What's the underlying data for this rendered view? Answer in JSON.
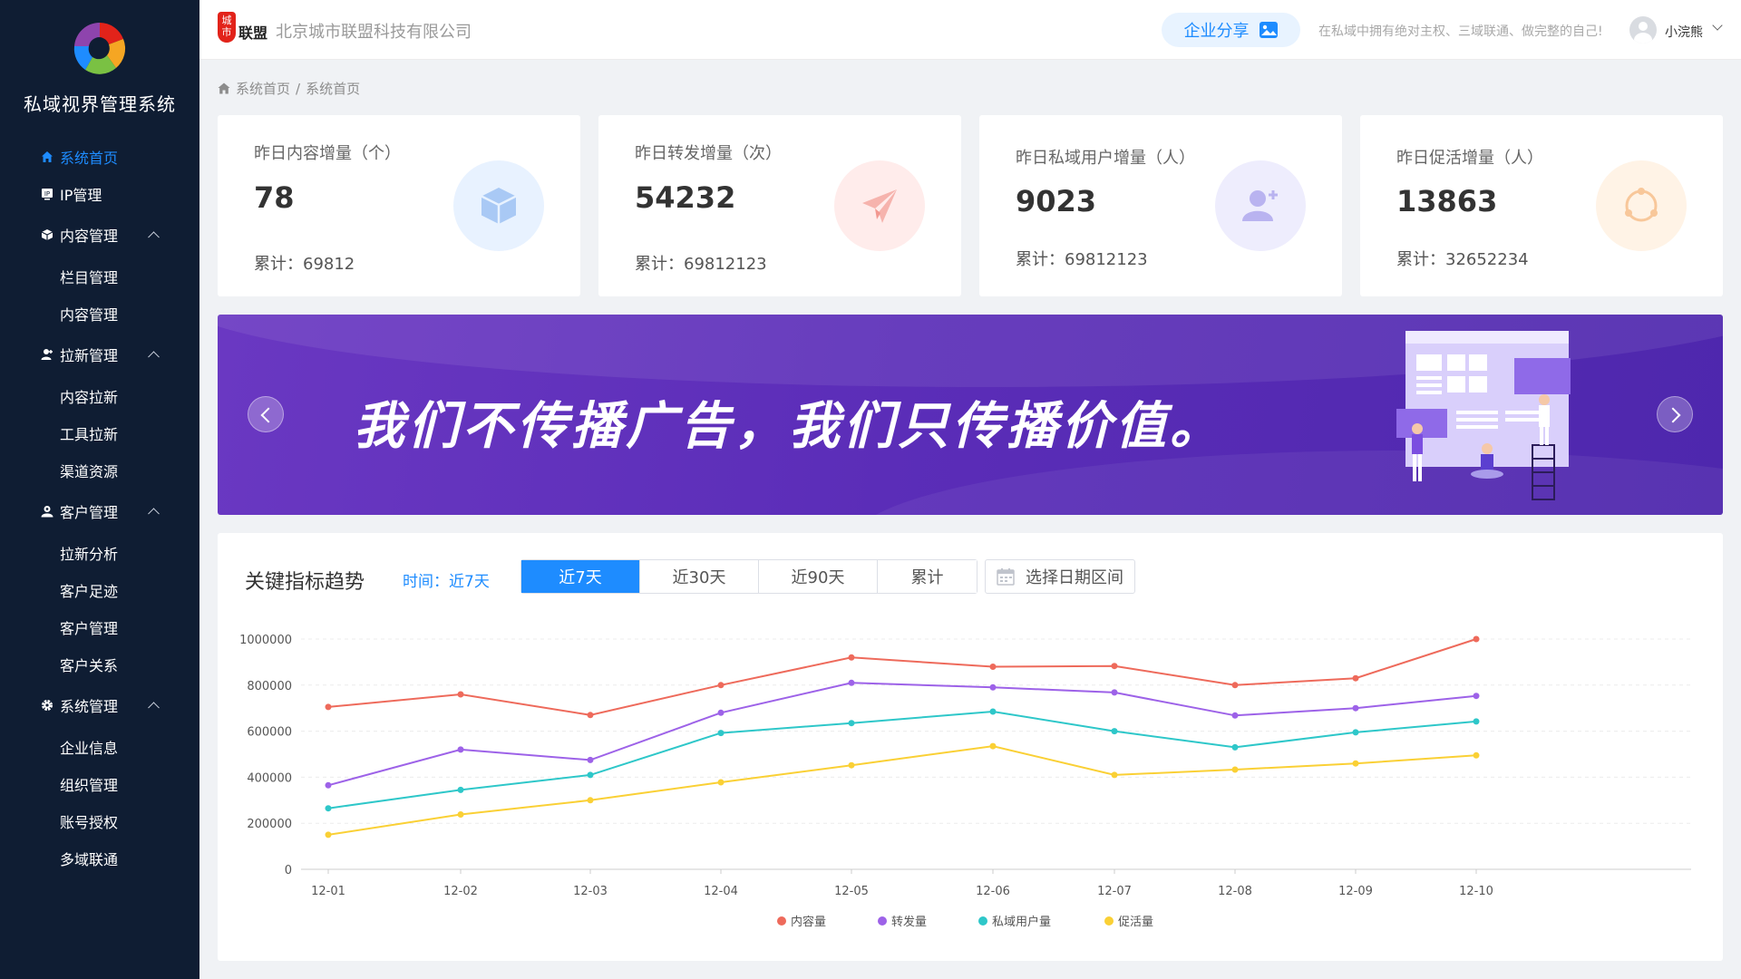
{
  "sidebar": {
    "title": "私域视界管理系统",
    "items": [
      {
        "label": "系统首页",
        "icon": "home-icon",
        "type": "item",
        "active": true
      },
      {
        "label": "IP管理",
        "icon": "ip-icon",
        "type": "item"
      },
      {
        "label": "内容管理",
        "icon": "cube-icon",
        "type": "group"
      },
      {
        "label": "栏目管理",
        "type": "sub"
      },
      {
        "label": "内容管理",
        "type": "sub"
      },
      {
        "label": "拉新管理",
        "icon": "user-plus-icon",
        "type": "group"
      },
      {
        "label": "内容拉新",
        "type": "sub"
      },
      {
        "label": "工具拉新",
        "type": "sub"
      },
      {
        "label": "渠道资源",
        "type": "sub"
      },
      {
        "label": "客户管理",
        "icon": "customer-icon",
        "type": "group"
      },
      {
        "label": "拉新分析",
        "type": "sub"
      },
      {
        "label": "客户足迹",
        "type": "sub"
      },
      {
        "label": "客户管理",
        "type": "sub"
      },
      {
        "label": "客户关系",
        "type": "sub"
      },
      {
        "label": "系统管理",
        "icon": "gear-icon",
        "type": "group"
      },
      {
        "label": "企业信息",
        "type": "sub"
      },
      {
        "label": "组织管理",
        "type": "sub"
      },
      {
        "label": "账号授权",
        "type": "sub"
      },
      {
        "label": "多域联通",
        "type": "sub"
      }
    ]
  },
  "header": {
    "brand_badge": "城市",
    "brand_small": "联盟",
    "company": "北京城市联盟科技有限公司",
    "share_label": "企业分享",
    "slogan": "在私域中拥有绝对主权、三域联通、做完整的自己!",
    "username": "小浣熊"
  },
  "breadcrumb": {
    "home": "系统首页",
    "current": "系统首页"
  },
  "cards": [
    {
      "title": "昨日内容增量（个）",
      "value": "78",
      "total_label": "累计：",
      "total": "69812",
      "icon": "cube-icon",
      "color": "#e8f2ff",
      "icon_color": "#a9c9f5"
    },
    {
      "title": "昨日转发增量（次）",
      "value": "54232",
      "total_label": "累计：",
      "total": "69812123",
      "icon": "paper-plane-icon",
      "color": "#ffeceb",
      "icon_color": "#f6b3ad"
    },
    {
      "title": "昨日私域用户增量（人）",
      "value": "9023",
      "total_label": "累计：",
      "total": "69812123",
      "icon": "user-add-icon",
      "color": "#eeedfd",
      "icon_color": "#b9b3f0"
    },
    {
      "title": "昨日促活增量（人）",
      "value": "13863",
      "total_label": "累计：",
      "total": "32652234",
      "icon": "cycle-icon",
      "color": "#fff3e6",
      "icon_color": "#f8c79a"
    }
  ],
  "banner": {
    "slogan": "我们不传播广告，我们只传播价值。"
  },
  "trend": {
    "title": "关键指标趋势",
    "time_label": "时间：近7天",
    "options": [
      "近7天",
      "近30天",
      "近90天",
      "累计"
    ],
    "selected": "近7天",
    "date_placeholder": "选择日期区间"
  },
  "chart_data": {
    "type": "line",
    "x": [
      "12-01",
      "12-02",
      "12-03",
      "12-04",
      "12-05",
      "12-06",
      "12-07",
      "12-08",
      "12-09",
      "12-10"
    ],
    "ylim": [
      0,
      1000000
    ],
    "yticks": [
      "0",
      "200000",
      "400000",
      "600000",
      "800000",
      "1000000"
    ],
    "grid": true,
    "legend": "bottom",
    "series": [
      {
        "name": "内容量",
        "color": "#ee6a5b",
        "values": [
          705000,
          760000,
          670000,
          800000,
          920000,
          880000,
          883000,
          800000,
          830000,
          1000000
        ]
      },
      {
        "name": "转发量",
        "color": "#9d62e8",
        "values": [
          365000,
          520000,
          475000,
          680000,
          810000,
          790000,
          768000,
          668000,
          700000,
          753000
        ]
      },
      {
        "name": "私域用户量",
        "color": "#2ec7c9",
        "values": [
          265000,
          345000,
          410000,
          592000,
          635000,
          685000,
          600000,
          530000,
          595000,
          642000
        ]
      },
      {
        "name": "促活量",
        "color": "#fad035",
        "values": [
          150000,
          238000,
          300000,
          378000,
          452000,
          535000,
          410000,
          433000,
          460000,
          495000
        ]
      }
    ]
  }
}
